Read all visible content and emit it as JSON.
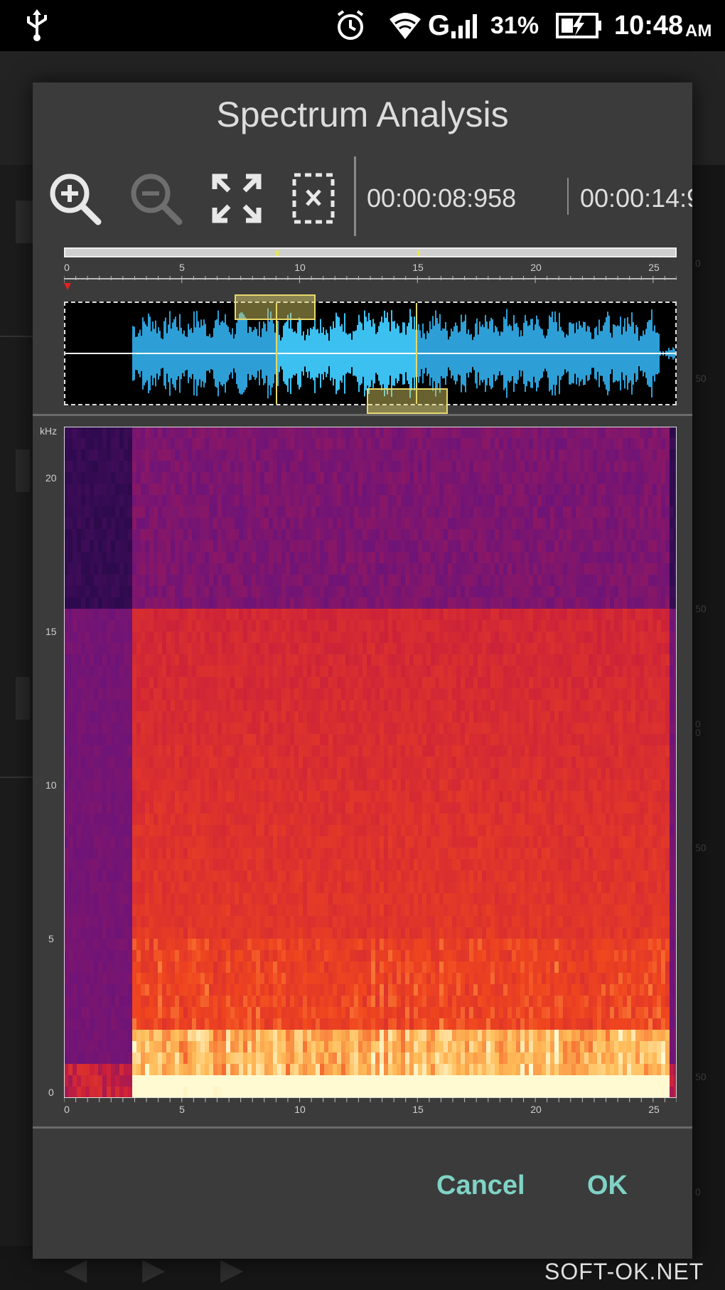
{
  "status_bar": {
    "usb_icon": "usb-icon",
    "alarm_icon": "alarm-icon",
    "wifi_icon": "wifi-icon",
    "network": "G",
    "signal_icon": "signal-icon",
    "battery_percent": "31%",
    "battery_icon": "battery-charging-icon",
    "time": "10:48",
    "ampm": "AM"
  },
  "dialog": {
    "title": "Spectrum Analysis",
    "toolbar": {
      "zoom_in_icon": "zoom-in-icon",
      "zoom_out_icon": "zoom-out-icon",
      "fit_icon": "expand-icon",
      "clear_selection_icon": "clear-selection-icon",
      "start_time": "00:00:08:958",
      "end_time": "00:00:14:9"
    },
    "timeline": {
      "ticks": [
        "0",
        "5",
        "10",
        "15",
        "20",
        "25"
      ],
      "selection_start_s": 8.958,
      "selection_end_s": 14.9,
      "duration_s": 26
    },
    "spectrogram": {
      "unit": "kHz",
      "y_ticks": [
        "20",
        "15",
        "10",
        "5",
        "0"
      ],
      "x_ticks": [
        "0",
        "5",
        "10",
        "15",
        "20",
        "25"
      ]
    },
    "buttons": {
      "cancel": "Cancel",
      "ok": "OK"
    }
  },
  "background_app": {
    "right_labels": [
      "0",
      "50",
      "50",
      "0",
      "0",
      "50",
      "50",
      "0"
    ]
  },
  "watermark": "SOFT-OK.NET",
  "colors": {
    "accent": "#7fd3c6",
    "waveform": "#2d9fd6",
    "waveform_selected": "#3cc0f0",
    "selection_handle": "#e6d86a",
    "dialog_bg": "#3b3b3b"
  }
}
